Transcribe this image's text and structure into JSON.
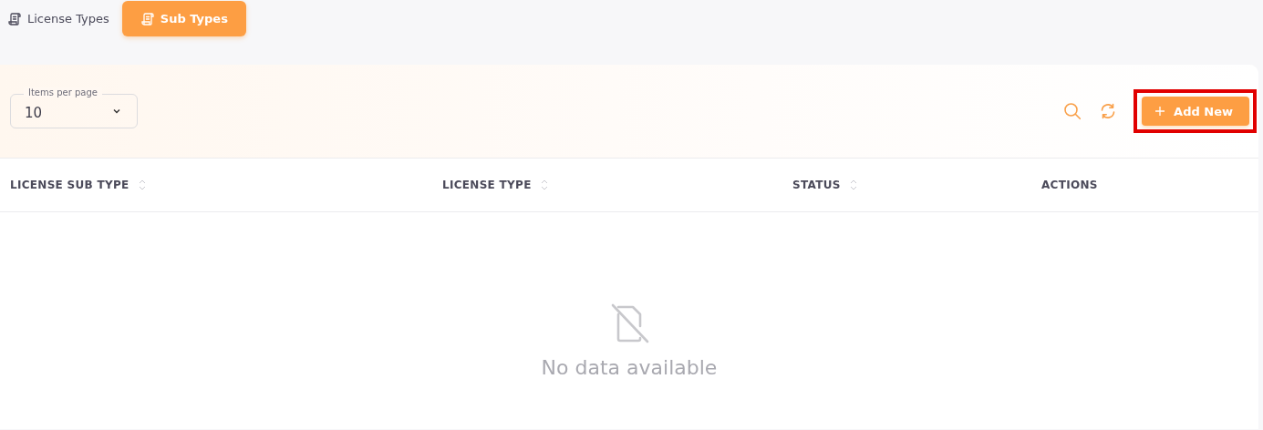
{
  "tabs": [
    {
      "label": "License Types",
      "selected": false
    },
    {
      "label": "Sub Types",
      "selected": true
    }
  ],
  "toolbar": {
    "items_per_page": {
      "label": "Items per page",
      "value": "10"
    },
    "add_button": {
      "label": "Add New",
      "highlighted": true
    }
  },
  "table": {
    "columns": [
      {
        "label": "LICENSE SUB TYPE",
        "sortable": true
      },
      {
        "label": "LICENSE TYPE",
        "sortable": true
      },
      {
        "label": "STATUS",
        "sortable": true
      },
      {
        "label": "ACTIONS",
        "sortable": false
      }
    ],
    "empty_message": "No data available"
  }
}
